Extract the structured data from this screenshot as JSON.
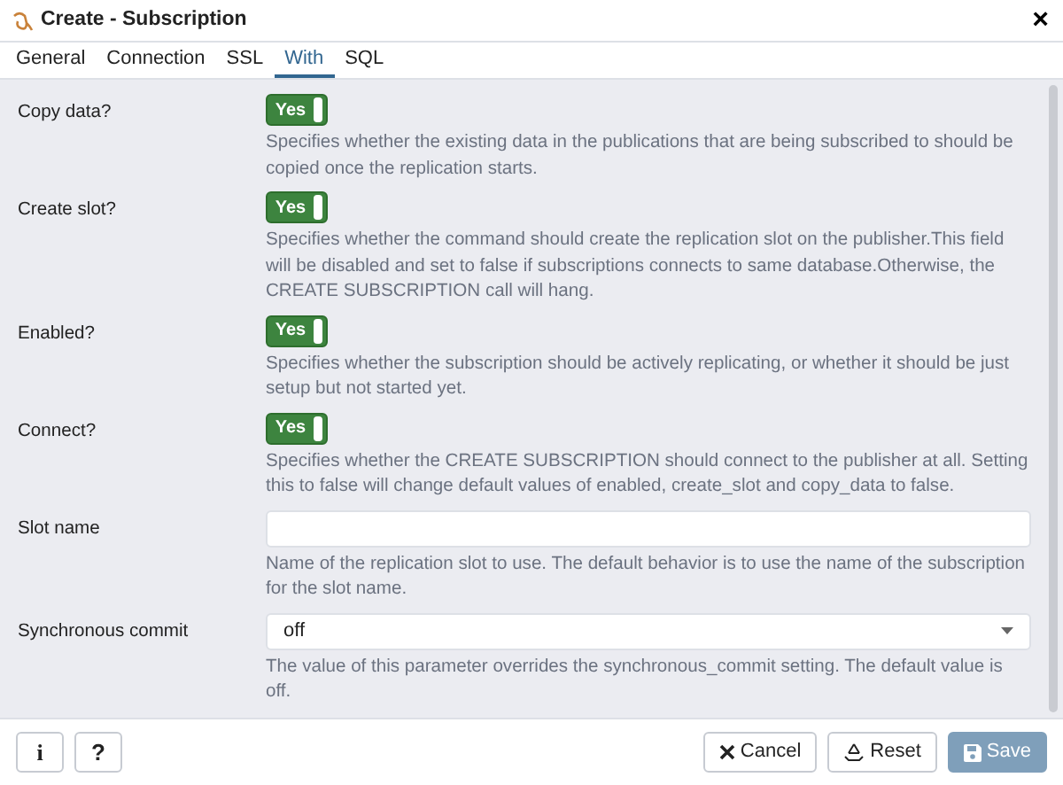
{
  "window": {
    "title": "Create - Subscription",
    "close": "×"
  },
  "tabs": [
    {
      "label": "General",
      "selected": false
    },
    {
      "label": "Connection",
      "selected": false
    },
    {
      "label": "SSL",
      "selected": false
    },
    {
      "label": "With",
      "selected": true
    },
    {
      "label": "SQL",
      "selected": false
    }
  ],
  "fields": [
    {
      "kind": "switch",
      "label": "Copy data?",
      "on": true,
      "switch_text": "Yes",
      "help": "Specifies whether the existing data in the publications that are being subscribed to should be copied once the replication starts."
    },
    {
      "kind": "switch",
      "label": "Create slot?",
      "on": true,
      "switch_text": "Yes",
      "help": "Specifies whether the command should create the replication slot on the publisher.This field will be disabled and set to false if subscriptions connects to same database.Otherwise, the CREATE SUBSCRIPTION call will hang."
    },
    {
      "kind": "switch",
      "label": "Enabled?",
      "on": true,
      "switch_text": "Yes",
      "help": "Specifies whether the subscription should be actively replicating, or whether it should be just setup but not started yet."
    },
    {
      "kind": "switch",
      "label": "Connect?",
      "on": true,
      "switch_text": "Yes",
      "help": "Specifies whether the CREATE SUBSCRIPTION should connect to the publisher at all. Setting this to false will change default values of enabled, create_slot and copy_data to false."
    },
    {
      "kind": "text",
      "label": "Slot name",
      "help": "Name of the replication slot to use. The default behavior is to use the name of the subscription for the slot name."
    },
    {
      "kind": "select",
      "label": "Synchronous commit",
      "value": "off",
      "help": "The value of this parameter overrides the synchronous_commit setting. The default value is off."
    }
  ],
  "footer": {
    "left_buttons": [
      {
        "kind": "info",
        "label": "i"
      },
      {
        "kind": "help",
        "label": "?"
      }
    ],
    "right_buttons": [
      {
        "kind": "cancel",
        "label": "Cancel"
      },
      {
        "kind": "reset",
        "label": "Reset"
      },
      {
        "kind": "save",
        "label": "Save",
        "disabled": true
      }
    ]
  }
}
